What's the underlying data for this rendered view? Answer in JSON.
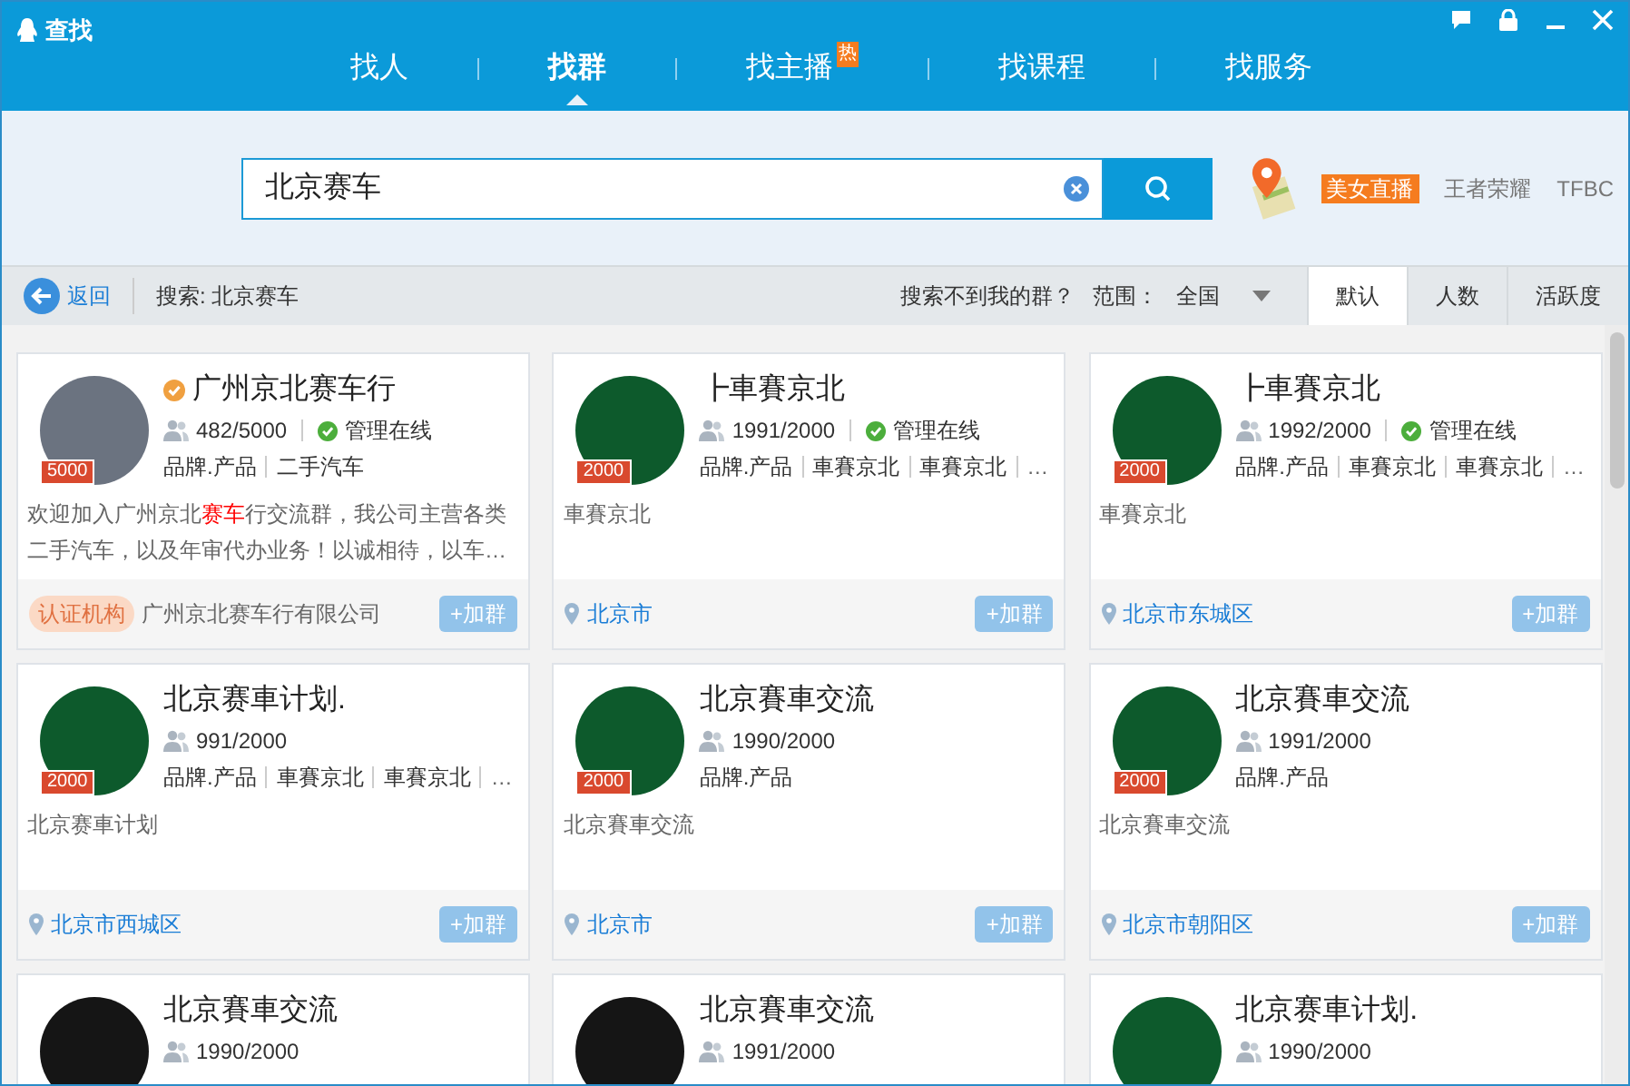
{
  "window": {
    "title": "查找"
  },
  "tabs": [
    {
      "label": "找人",
      "selected": false
    },
    {
      "label": "找群",
      "selected": true
    },
    {
      "label": "找主播",
      "selected": false,
      "badge": "热"
    },
    {
      "label": "找课程",
      "selected": false
    },
    {
      "label": "找服务",
      "selected": false
    }
  ],
  "search": {
    "value": "北京赛车"
  },
  "hot_links": [
    {
      "label": "美女直播",
      "kind": "badge"
    },
    {
      "label": "王者荣耀",
      "kind": "plain"
    },
    {
      "label": "TFBC",
      "kind": "plain"
    }
  ],
  "toolbar": {
    "back": "返回",
    "query": "搜索: 北京赛车",
    "help": "搜索不到我的群？",
    "range_label": "范围：",
    "range_value": "全国",
    "sorts": [
      {
        "label": "默认",
        "selected": true
      },
      {
        "label": "人数",
        "selected": false
      },
      {
        "label": "活跃度",
        "selected": false
      }
    ]
  },
  "cards": [
    {
      "avatar": {
        "kind": "photo",
        "badge": "5000"
      },
      "verified": true,
      "name": "广州京北赛车行",
      "members": "482/5000",
      "admin": "管理在线",
      "tags": [
        "品牌.产品",
        "二手汽车"
      ],
      "description": "欢迎加入广州京北**赛车**行交流群，我公司主营各类二手汽车，以及年审代办业务！以诚相待，以车…",
      "footer": {
        "kind": "org",
        "cert": "认证机构",
        "org": "广州京北赛车行有限公司",
        "join": "+加群"
      }
    },
    {
      "avatar": {
        "kind": "green",
        "badge": "2000"
      },
      "verified": false,
      "name": "┣車賽京北",
      "members": "1991/2000",
      "admin": "管理在线",
      "tags": [
        "品牌.产品",
        "車賽京北",
        "車賽京北"
      ],
      "more": "…",
      "description": "車賽京北",
      "footer": {
        "kind": "location",
        "location": "北京市",
        "join": "+加群"
      }
    },
    {
      "avatar": {
        "kind": "green",
        "badge": "2000"
      },
      "verified": false,
      "name": "┣車賽京北",
      "members": "1992/2000",
      "admin": "管理在线",
      "tags": [
        "品牌.产品",
        "車賽京北",
        "車賽京北"
      ],
      "more": "…",
      "description": "車賽京北",
      "footer": {
        "kind": "location",
        "location": "北京市东城区",
        "join": "+加群"
      }
    },
    {
      "avatar": {
        "kind": "green",
        "badge": "2000"
      },
      "verified": false,
      "name": "北京赛車计划.",
      "members": "991/2000",
      "tags": [
        "品牌.产品",
        "車賽京北",
        "車賽京北"
      ],
      "more": "…",
      "description": "北京赛車计划",
      "footer": {
        "kind": "location",
        "location": "北京市西城区",
        "join": "+加群"
      }
    },
    {
      "avatar": {
        "kind": "green",
        "badge": "2000"
      },
      "verified": false,
      "name": "北京賽車交流",
      "members": "1990/2000",
      "tags": [
        "品牌.产品"
      ],
      "description": "北京賽車交流",
      "footer": {
        "kind": "location",
        "location": "北京市",
        "join": "+加群"
      }
    },
    {
      "avatar": {
        "kind": "green",
        "badge": "2000"
      },
      "verified": false,
      "name": "北京賽車交流",
      "members": "1991/2000",
      "tags": [
        "品牌.产品"
      ],
      "description": "北京賽車交流",
      "footer": {
        "kind": "location",
        "location": "北京市朝阳区",
        "join": "+加群"
      }
    },
    {
      "avatar": {
        "kind": "black"
      },
      "verified": false,
      "name": "北京賽車交流",
      "members": "1990/2000"
    },
    {
      "avatar": {
        "kind": "black"
      },
      "verified": false,
      "name": "北京賽車交流",
      "members": "1991/2000"
    },
    {
      "avatar": {
        "kind": "green"
      },
      "verified": false,
      "name": "北京赛車计划.",
      "members": "1990/2000"
    }
  ]
}
